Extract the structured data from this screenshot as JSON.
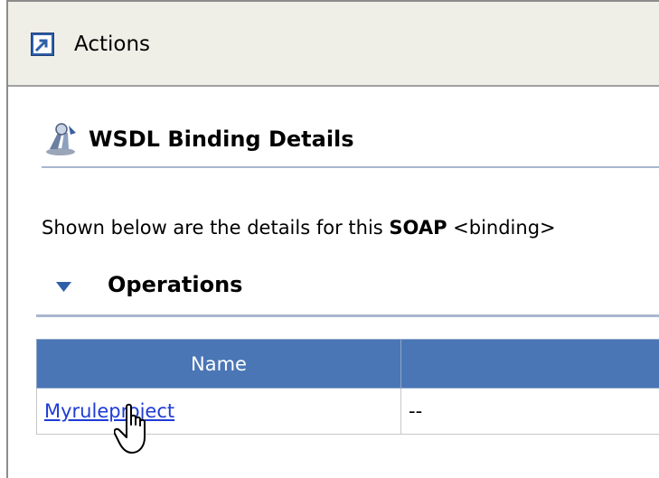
{
  "actions": {
    "title": "Actions",
    "icon": "shortcut-arrow-icon"
  },
  "details": {
    "title": "WSDL Binding Details",
    "icon": "wsdl-binding-icon",
    "description_prefix": "Shown below are the details for this",
    "description_bold": "SOAP",
    "description_suffix": "<binding>"
  },
  "operations": {
    "title": "Operations",
    "columns": [
      "Name",
      ""
    ],
    "rows": [
      {
        "name": "Myruleproject",
        "value": "--"
      }
    ]
  },
  "colors": {
    "header_bg": "#4a76b5",
    "link": "#1f3cd6",
    "toolbar_bg": "#efefe7"
  }
}
